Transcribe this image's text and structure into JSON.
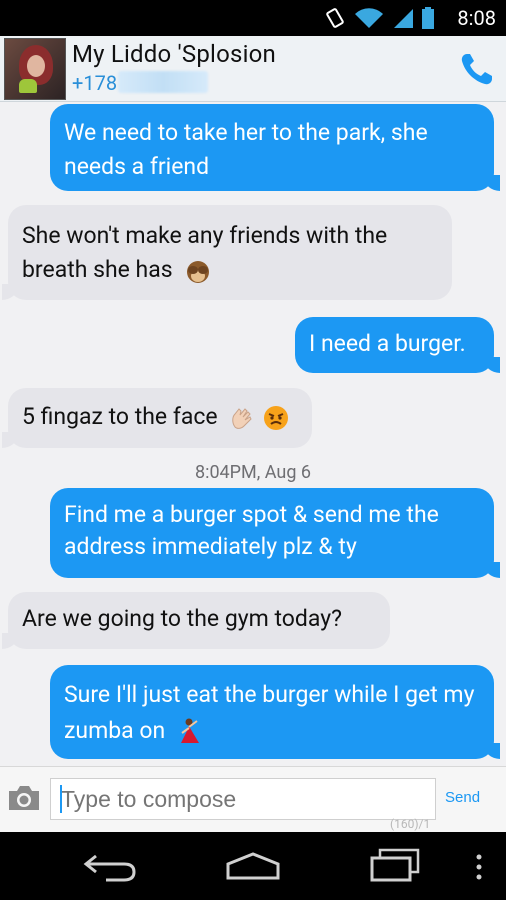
{
  "status_bar": {
    "time": "8:08"
  },
  "header": {
    "contact_name": "My Liddo 'Splosion",
    "contact_number": "+178"
  },
  "messages": [
    {
      "direction": "out",
      "text": "We need to take her to the park, she needs a friend"
    },
    {
      "direction": "in",
      "text": "She won't make any friends with the breath she has",
      "emoji": "monkey-see-no-evil"
    },
    {
      "direction": "out",
      "text": "I need a burger."
    },
    {
      "direction": "in",
      "text": "5 fingaz to the face",
      "emoji": "waving-hand, angry-face"
    },
    {
      "direction": "out",
      "text": "Find me a burger spot & send me the address immediately plz & ty"
    },
    {
      "direction": "in",
      "text": "Are we going to the gym today?"
    },
    {
      "direction": "out",
      "text": "Sure I'll just eat the burger while I get my zumba on",
      "emoji": "dancer"
    }
  ],
  "timestamp": "8:04PM, Aug 6",
  "compose": {
    "placeholder": "Type to compose",
    "counter": "(160)/1",
    "send_label": "Send"
  },
  "colors": {
    "outgoing_bubble": "#1c98f3",
    "incoming_bubble": "#e5e5ea",
    "accent": "#1c98f3"
  }
}
